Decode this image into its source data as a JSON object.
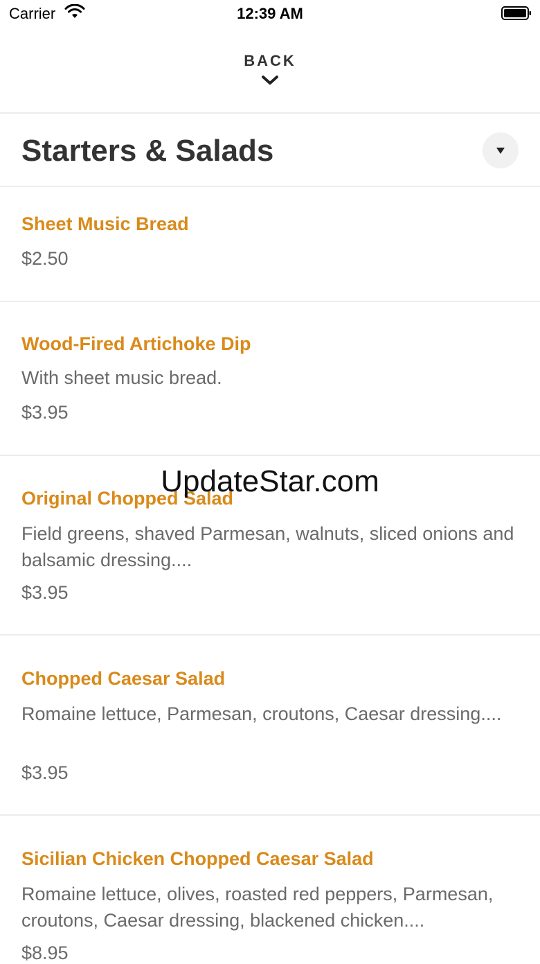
{
  "status_bar": {
    "carrier": "Carrier",
    "time": "12:39 AM"
  },
  "nav": {
    "back_label": "BACK"
  },
  "section": {
    "title": "Starters & Salads"
  },
  "items": [
    {
      "name": "Sheet Music Bread",
      "description": "",
      "price": "$2.50"
    },
    {
      "name": "Wood-Fired Artichoke Dip",
      "description": "With sheet music bread.",
      "price": "$3.95"
    },
    {
      "name": "Original Chopped Salad",
      "description": "Field greens, shaved Parmesan, walnuts, sliced onions and balsamic dressing....",
      "price": "$3.95"
    },
    {
      "name": "Chopped Caesar Salad",
      "description": "Romaine lettuce, Parmesan, croutons, Caesar dressing....",
      "price": "$3.95"
    },
    {
      "name": "Sicilian Chicken Chopped Caesar Salad",
      "description": "Romaine lettuce, olives, roasted red peppers, Parmesan, croutons, Caesar dressing, blackened chicken....",
      "price": "$8.95"
    }
  ],
  "watermark": "UpdateStar.com",
  "colors": {
    "accent": "#d98a1a",
    "title": "#333333",
    "secondary_text": "#6a6a6a",
    "divider": "#ececec"
  }
}
